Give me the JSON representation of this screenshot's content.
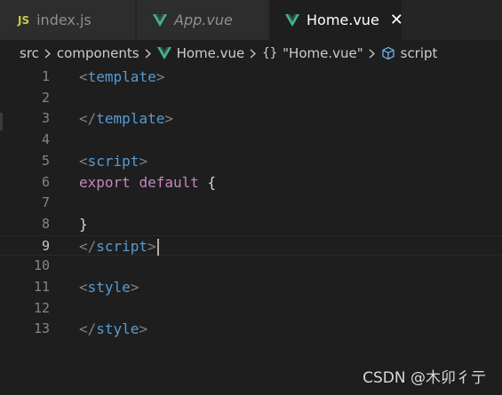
{
  "tabs": [
    {
      "label": "index.js",
      "icon": "js-file-icon",
      "icon_text": "JS",
      "italic": false,
      "active": false
    },
    {
      "label": "App.vue",
      "icon": "vue-file-icon",
      "italic": true,
      "active": false
    },
    {
      "label": "Home.vue",
      "icon": "vue-file-icon",
      "italic": false,
      "active": true,
      "close": "✕"
    }
  ],
  "breadcrumb": {
    "folder1": "src",
    "folder2": "components",
    "file": "Home.vue",
    "braces": "{}",
    "object": "\"Home.vue\"",
    "symbol": "script"
  },
  "editor": {
    "line_numbers": [
      "1",
      "2",
      "3",
      "4",
      "5",
      "6",
      "7",
      "8",
      "9",
      "10",
      "11",
      "12",
      "13"
    ],
    "current_line": 9,
    "lines": {
      "l1_tag": "template",
      "l3_tag": "template",
      "l5_tag": "script",
      "l6_kw1": "export",
      "l6_kw2": "default",
      "l6_brace": "{",
      "l8_brace": "}",
      "l9_tag": "script",
      "l11_tag": "style",
      "l13_tag": "style"
    }
  },
  "watermark": "CSDN @木卯彳亍",
  "colors": {
    "tag": "#569cd6",
    "bracket": "#808080",
    "keyword": "#c586c0",
    "vue_green": "#41b883",
    "js_yellow": "#cbcb41"
  }
}
